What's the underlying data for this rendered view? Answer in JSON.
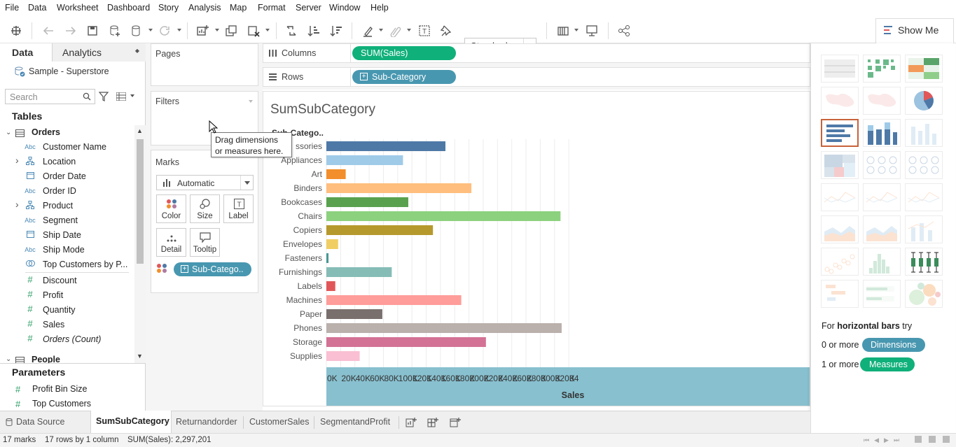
{
  "menu": [
    "File",
    "Data",
    "Worksheet",
    "Dashboard",
    "Story",
    "Analysis",
    "Map",
    "Format",
    "Server",
    "Window",
    "Help"
  ],
  "toolbar": {
    "standard": "Standard",
    "show_me": "Show Me"
  },
  "left_pane": {
    "tab_data": "Data",
    "tab_analytics": "Analytics",
    "datasource": "Sample - Superstore",
    "search_placeholder": "Search",
    "tables_heading": "Tables",
    "orders_table": "Orders",
    "fields": [
      {
        "type": "Abc",
        "label": "Customer Name",
        "expand": false,
        "kind": "dim"
      },
      {
        "type": "hier",
        "label": "Location",
        "expand": true,
        "kind": "dim"
      },
      {
        "type": "date",
        "label": "Order Date",
        "expand": false,
        "kind": "dim"
      },
      {
        "type": "Abc",
        "label": "Order ID",
        "expand": false,
        "kind": "dim"
      },
      {
        "type": "hier",
        "label": "Product",
        "expand": true,
        "kind": "dim"
      },
      {
        "type": "Abc",
        "label": "Segment",
        "expand": false,
        "kind": "dim"
      },
      {
        "type": "date",
        "label": "Ship Date",
        "expand": false,
        "kind": "dim"
      },
      {
        "type": "Abc",
        "label": "Ship Mode",
        "expand": false,
        "kind": "dim"
      },
      {
        "type": "set",
        "label": "Top Customers by P...",
        "expand": false,
        "kind": "dim"
      },
      {
        "type": "#",
        "label": "Discount",
        "expand": false,
        "kind": "meas"
      },
      {
        "type": "#",
        "label": "Profit",
        "expand": false,
        "kind": "meas"
      },
      {
        "type": "#",
        "label": "Quantity",
        "expand": false,
        "kind": "meas"
      },
      {
        "type": "#",
        "label": "Sales",
        "expand": false,
        "kind": "meas"
      },
      {
        "type": "#",
        "label": "Orders (Count)",
        "expand": false,
        "kind": "meas"
      }
    ],
    "people_table": "People",
    "parameters_heading": "Parameters",
    "parameters": [
      "Profit Bin Size",
      "Top Customers"
    ]
  },
  "cards": {
    "pages": "Pages",
    "filters": "Filters",
    "marks": "Marks",
    "mark_type": "Automatic",
    "buttons": [
      "Color",
      "Size",
      "Label",
      "Detail",
      "Tooltip"
    ],
    "color_pill": "Sub-Catego.."
  },
  "tooltip": {
    "line1": "Drag dimensions",
    "line2": "or measures here."
  },
  "shelves": {
    "columns_label": "Columns",
    "columns_pill": "SUM(Sales)",
    "rows_label": "Rows",
    "rows_pill": "Sub-Category"
  },
  "sheet": {
    "title": "SumSubCategory",
    "row_header": "Sub-Catego.."
  },
  "chart_data": {
    "type": "bar",
    "orientation": "horizontal",
    "xlabel": "Sales",
    "xlim": [
      0,
      340000
    ],
    "grid": true,
    "ticks": [
      "0K",
      "20K",
      "40K",
      "60K",
      "80K",
      "100K",
      "120K",
      "140K",
      "160K",
      "180K",
      "200K",
      "220K",
      "240K",
      "260K",
      "280K",
      "300K",
      "320K",
      "34"
    ],
    "categories": [
      "Accessories",
      "Appliances",
      "Art",
      "Binders",
      "Bookcases",
      "Chairs",
      "Copiers",
      "Envelopes",
      "Fasteners",
      "Furnishings",
      "Labels",
      "Machines",
      "Paper",
      "Phones",
      "Storage",
      "Supplies"
    ],
    "category_labels": [
      "ssories",
      "Appliances",
      "Art",
      "Binders",
      "Bookcases",
      "Chairs",
      "Copiers",
      "Envelopes",
      "Fasteners",
      "Furnishings",
      "Labels",
      "Machines",
      "Paper",
      "Phones",
      "Storage",
      "Supplies"
    ],
    "values": [
      167000,
      107500,
      27100,
      203400,
      114900,
      328400,
      149500,
      16500,
      3000,
      91700,
      12500,
      189200,
      78500,
      330000,
      223800,
      46700
    ],
    "colors": [
      "#4e79a7",
      "#a0cbe8",
      "#f28e2b",
      "#ffbe7d",
      "#59a14f",
      "#8cd17d",
      "#b6992d",
      "#f1ce63",
      "#499894",
      "#86bcb6",
      "#e15759",
      "#ff9d9a",
      "#79706e",
      "#bab0ac",
      "#d37295",
      "#fabfd2"
    ]
  },
  "show_me": {
    "hint_prefix": "For ",
    "hint_bold": "horizontal bars",
    "hint_suffix": " try",
    "dims_prefix": "0 or more",
    "dims_pill": "Dimensions",
    "meas_prefix": "1 or more",
    "meas_pill": "Measures",
    "colors": {
      "dimensions": "#4897b0",
      "measures": "#10b07a",
      "selected": "#c8623a"
    }
  },
  "sheet_tabs": [
    "Data Source",
    "SumSubCategory",
    "Returnandorder",
    "CustomerSales",
    "SegmentandProfit"
  ],
  "status": {
    "marks": "17 marks",
    "rows": "17 rows by 1 column",
    "sum": "SUM(Sales): 2,297,201"
  }
}
